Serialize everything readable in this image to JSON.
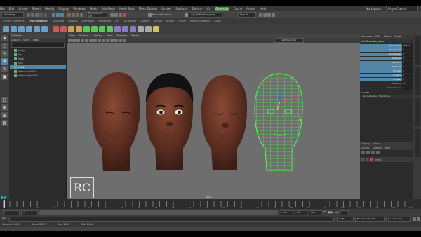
{
  "menubar": {
    "items": [
      "File",
      "Edit",
      "Create",
      "Select",
      "Modify",
      "Display",
      "Windows",
      "Mesh",
      "Edit Mesh",
      "Mesh Tools",
      "Mesh Display",
      "Curves",
      "Surfaces",
      "Deform",
      "UV",
      "Generate",
      "Cache",
      "Arnold",
      "Help"
    ],
    "highlight_index": 15,
    "workspace_label": "Workspace:",
    "workspace_value": "Maya Classic*"
  },
  "statusline": {
    "mode": "Modeling",
    "symmetry": "Symmetry: Off",
    "no_live": "No Live Surface",
    "object_field": "def_Reflective_Face",
    "signin": "Sign In"
  },
  "shelf": {
    "tabs": [
      "Curves / Surfaces",
      "Poly Modeling",
      "Sculpting",
      "Rigging",
      "Animation",
      "Rendering",
      "FX",
      "FX Caching",
      "Custom",
      "Arnold",
      "Bifrost",
      "MASH",
      "Motion Graphics",
      "XGen"
    ],
    "selected": "Poly Modeling"
  },
  "outliner": {
    "title": "Outliner",
    "menu": [
      "Display",
      "Show",
      "Help"
    ],
    "items": [
      {
        "name": "persp",
        "selected": false
      },
      {
        "name": "top",
        "selected": false
      },
      {
        "name": "front",
        "selected": false
      },
      {
        "name": "side",
        "selected": false
      },
      {
        "name": "head",
        "selected": true
      },
      {
        "name": "defaultLightSet",
        "selected": false
      },
      {
        "name": "defaultObjectSet",
        "selected": false
      }
    ]
  },
  "viewport": {
    "menu": [
      "View",
      "Shading",
      "Lighting",
      "Show",
      "Renderer",
      "Panels"
    ],
    "camera_field": "sRGB gamma",
    "camera_label": "persp",
    "logo_text": "RC"
  },
  "channelbox": {
    "tabs": [
      "Channels",
      "Edit",
      "Object",
      "Show"
    ],
    "object": "def_Reflective_Face",
    "attributes": [
      {
        "name": "Translate X",
        "value": "28.401"
      },
      {
        "name": "Translate Y",
        "value": "0"
      },
      {
        "name": "Translate Z",
        "value": "0"
      },
      {
        "name": "Rotate X",
        "value": "0"
      },
      {
        "name": "Rotate Y",
        "value": "0"
      },
      {
        "name": "Rotate Z",
        "value": "0"
      },
      {
        "name": "Scale X",
        "value": "1"
      },
      {
        "name": "Scale Y",
        "value": "1"
      },
      {
        "name": "Scale Z",
        "value": "1"
      },
      {
        "name": "Visibility",
        "value": "on"
      },
      {
        "name": "Smoothness",
        "value": "1"
      }
    ],
    "shapes_label": "SHAPES",
    "shape_item": "def_Reflective_FaceShape",
    "layer_tabs": [
      "Display",
      "Anim"
    ],
    "layer_menu": [
      "Layers",
      "Options",
      "Help"
    ],
    "layer_name": "layer1"
  },
  "timeline": {
    "ticks": [
      "1",
      "5",
      "10",
      "15",
      "20",
      "25",
      "30",
      "35",
      "40",
      "45",
      "50",
      "55",
      "60",
      "65",
      "70",
      "75",
      "80",
      "85",
      "90",
      "95",
      "100",
      "105",
      "110",
      "115",
      "120"
    ],
    "current": "1"
  },
  "range": {
    "start": "1",
    "start2": "1",
    "end": "120",
    "end2": "120",
    "end3": "200",
    "fps": "24 fps",
    "char_set": "No Character Set",
    "anim_layer": "No Anim Layer"
  },
  "mel": {
    "label": "MEL"
  },
  "helpline": {
    "items": [
      "Sampled: 1.000",
      "Sched 3,667",
      "Cost 1.000",
      "Dist 1.000"
    ]
  }
}
